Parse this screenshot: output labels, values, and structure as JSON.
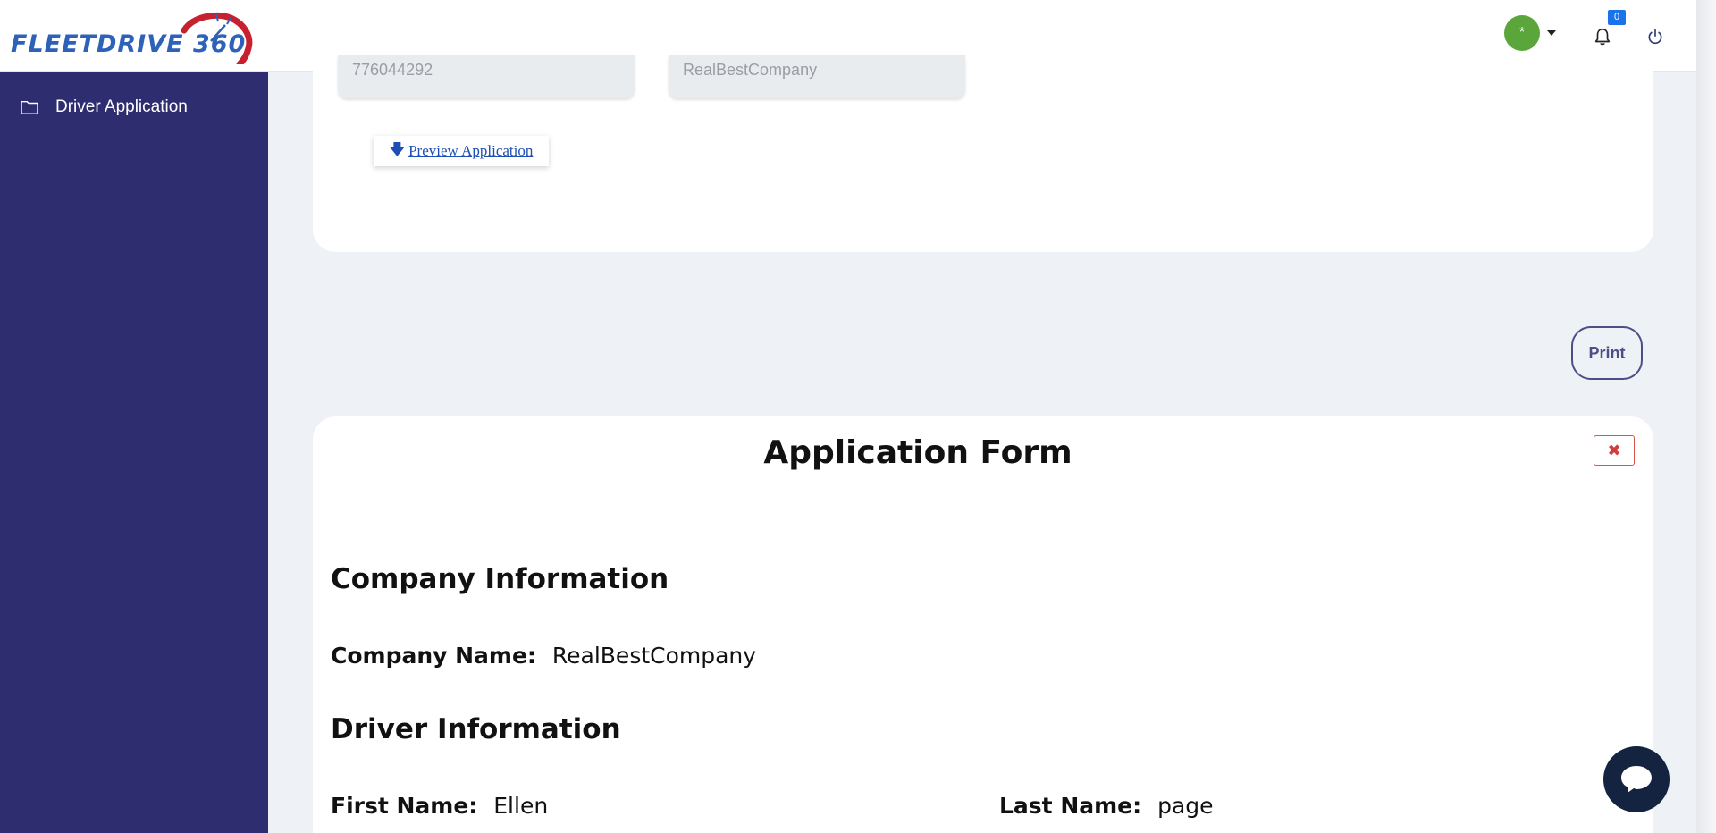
{
  "header": {
    "logo_text": "FLEETDRIVE 360",
    "avatar_initial": "*",
    "notification_count": "0"
  },
  "sidebar": {
    "items": [
      {
        "label": "Driver Application"
      }
    ]
  },
  "top_card": {
    "field_1_value": "776044292",
    "field_2_value": "RealBestCompany",
    "preview_label": "Preview Application"
  },
  "print_label": "Print",
  "form": {
    "title": "Application Form",
    "close_icon": "times-icon",
    "company_section": "Company Information",
    "company_name_label": "Company Name:",
    "company_name_value": "RealBestCompany",
    "driver_section": "Driver Information",
    "first_name_label": "First Name:",
    "first_name_value": "Ellen",
    "last_name_label": "Last Name:",
    "last_name_value": "page"
  },
  "colors": {
    "sidebar": "#2e2d70",
    "brand_blue": "#2e62b8",
    "brand_red": "#c7202f",
    "avatar": "#5aa63a",
    "chat": "#14233f"
  }
}
